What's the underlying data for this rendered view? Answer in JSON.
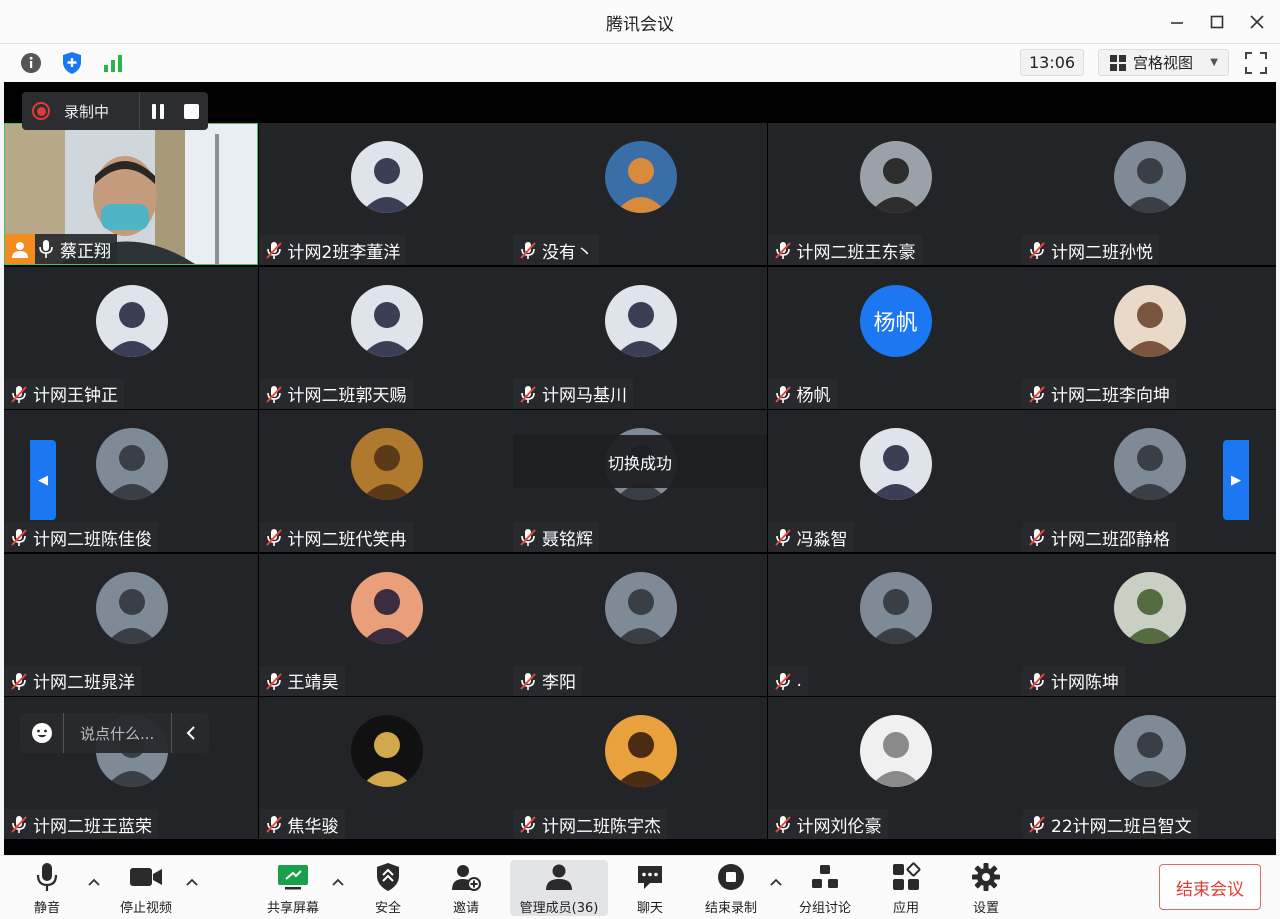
{
  "window": {
    "title": "腾讯会议"
  },
  "toolbar": {
    "clock": "13:06",
    "view_mode": "宫格视图"
  },
  "recording": {
    "label": "录制中"
  },
  "toast": "切换成功",
  "chat": {
    "placeholder": "说点什么..."
  },
  "participants": [
    {
      "name": "蔡正翔",
      "host": true,
      "mic": "on",
      "avatar": "camera-feed"
    },
    {
      "name": "计网2班李董洋",
      "mic": "muted",
      "avatar": "anime-avatar"
    },
    {
      "name": "没有丶",
      "mic": "muted",
      "avatar": "dog-avatar"
    },
    {
      "name": "计网二班王东豪",
      "mic": "muted",
      "avatar": "cartoon-avatar"
    },
    {
      "name": "计网二班孙悦",
      "mic": "muted",
      "avatar": "photo-avatar"
    },
    {
      "name": "计网王钟正",
      "mic": "muted",
      "avatar": "anime-avatar"
    },
    {
      "name": "计网二班郭天赐",
      "mic": "muted",
      "avatar": "anime-avatar"
    },
    {
      "name": "计网马基川",
      "mic": "muted",
      "avatar": "anime-avatar"
    },
    {
      "name": "杨帆",
      "mic": "muted",
      "avatar": "text-avatar",
      "avatar_text": "杨帆"
    },
    {
      "name": "计网二班李向坤",
      "mic": "muted",
      "avatar": "child-photo-avatar"
    },
    {
      "name": "计网二班陈佳俊",
      "mic": "muted",
      "avatar": "photo-avatar"
    },
    {
      "name": "计网二班代笑冉",
      "mic": "muted",
      "avatar": "shadow-avatar"
    },
    {
      "name": "聂铭辉",
      "mic": "muted",
      "avatar": "photo-avatar"
    },
    {
      "name": "冯淼智",
      "mic": "muted",
      "avatar": "anime-avatar"
    },
    {
      "name": "计网二班邵静格",
      "mic": "muted",
      "avatar": "photo-avatar"
    },
    {
      "name": "计网二班晁洋",
      "mic": "muted",
      "avatar": "photo-avatar"
    },
    {
      "name": "王靖昊",
      "mic": "muted",
      "avatar": "sunset-avatar"
    },
    {
      "name": "李阳",
      "mic": "muted",
      "avatar": "photo-avatar"
    },
    {
      "name": ".",
      "mic": "muted",
      "avatar": "photo-avatar"
    },
    {
      "name": "计网陈坤",
      "mic": "muted",
      "avatar": "plant-avatar"
    },
    {
      "name": "计网二班王蓝荣",
      "mic": "muted",
      "avatar": "photo-avatar"
    },
    {
      "name": "焦华骏",
      "mic": "muted",
      "avatar": "bridge-logo-avatar"
    },
    {
      "name": "计网二班陈宇杰",
      "mic": "muted",
      "avatar": "silhouette-avatar"
    },
    {
      "name": "计网刘伦豪",
      "mic": "muted",
      "avatar": "pixel-avatar"
    },
    {
      "name": "22计网二班吕智文",
      "mic": "muted",
      "avatar": "photo-avatar"
    }
  ],
  "bottom": {
    "mute": "静音",
    "stop_video": "停止视频",
    "share_screen": "共享屏幕",
    "security": "安全",
    "invite": "邀请",
    "manage_members": "管理成员(36)",
    "chat": "聊天",
    "end_recording": "结束录制",
    "breakout": "分组讨论",
    "apps": "应用",
    "settings": "设置",
    "end_meeting": "结束会议"
  },
  "colors": {
    "accent_blue": "#1c78f2",
    "active_speaker": "#38c66a",
    "recording_red": "#e03a3a",
    "end_red": "#e03c36"
  }
}
